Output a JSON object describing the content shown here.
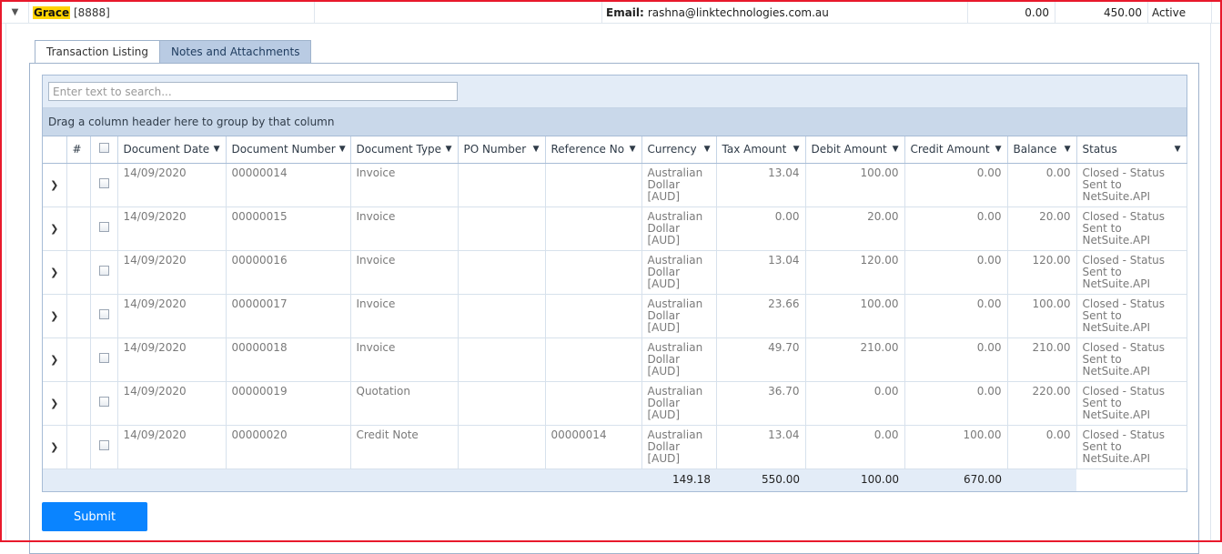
{
  "customer": {
    "name_highlight": "Grace",
    "name_code": "[8888]",
    "email_label": "Email:",
    "email_value": "rashna@linktechnologies.com.au",
    "value1": "0.00",
    "value2": "450.00",
    "status": "Active"
  },
  "tabs": [
    {
      "label": "Transaction Listing",
      "active": true
    },
    {
      "label": "Notes and Attachments",
      "active": false
    }
  ],
  "search": {
    "placeholder": "Enter text to search..."
  },
  "group_panel": "Drag a column header here to group by that column",
  "columns": [
    "#",
    "",
    "Document Date",
    "Document Number",
    "Document Type",
    "PO Number",
    "Reference No",
    "Currency",
    "Tax Amount",
    "Debit Amount",
    "Credit Amount",
    "Balance",
    "Status"
  ],
  "rows": [
    {
      "date": "14/09/2020",
      "number": "00000014",
      "type": "Invoice",
      "po": "",
      "ref": "",
      "currency": "Australian Dollar [AUD]",
      "tax": "13.04",
      "debit": "100.00",
      "credit": "0.00",
      "balance": "0.00",
      "status": "Closed - Status Sent to NetSuite.API"
    },
    {
      "date": "14/09/2020",
      "number": "00000015",
      "type": "Invoice",
      "po": "",
      "ref": "",
      "currency": "Australian Dollar [AUD]",
      "tax": "0.00",
      "debit": "20.00",
      "credit": "0.00",
      "balance": "20.00",
      "status": "Closed - Status Sent to NetSuite.API"
    },
    {
      "date": "14/09/2020",
      "number": "00000016",
      "type": "Invoice",
      "po": "",
      "ref": "",
      "currency": "Australian Dollar [AUD]",
      "tax": "13.04",
      "debit": "120.00",
      "credit": "0.00",
      "balance": "120.00",
      "status": "Closed - Status Sent to NetSuite.API"
    },
    {
      "date": "14/09/2020",
      "number": "00000017",
      "type": "Invoice",
      "po": "",
      "ref": "",
      "currency": "Australian Dollar [AUD]",
      "tax": "23.66",
      "debit": "100.00",
      "credit": "0.00",
      "balance": "100.00",
      "status": "Closed - Status Sent to NetSuite.API"
    },
    {
      "date": "14/09/2020",
      "number": "00000018",
      "type": "Invoice",
      "po": "",
      "ref": "",
      "currency": "Australian Dollar [AUD]",
      "tax": "49.70",
      "debit": "210.00",
      "credit": "0.00",
      "balance": "210.00",
      "status": "Closed - Status Sent to NetSuite.API"
    },
    {
      "date": "14/09/2020",
      "number": "00000019",
      "type": "Quotation",
      "po": "",
      "ref": "",
      "currency": "Australian Dollar [AUD]",
      "tax": "36.70",
      "debit": "0.00",
      "credit": "0.00",
      "balance": "220.00",
      "status": "Closed - Status Sent to NetSuite.API"
    },
    {
      "date": "14/09/2020",
      "number": "00000020",
      "type": "Credit Note",
      "po": "",
      "ref": "00000014",
      "currency": "Australian Dollar [AUD]",
      "tax": "13.04",
      "debit": "0.00",
      "credit": "100.00",
      "balance": "0.00",
      "status": "Closed - Status Sent to NetSuite.API"
    }
  ],
  "totals": {
    "tax": "149.18",
    "debit": "550.00",
    "credit": "100.00",
    "balance": "670.00"
  },
  "submit_label": "Submit",
  "colors": {
    "accent": "#0a84ff",
    "highlight": "#ffd400",
    "frame": "#e8192c"
  }
}
